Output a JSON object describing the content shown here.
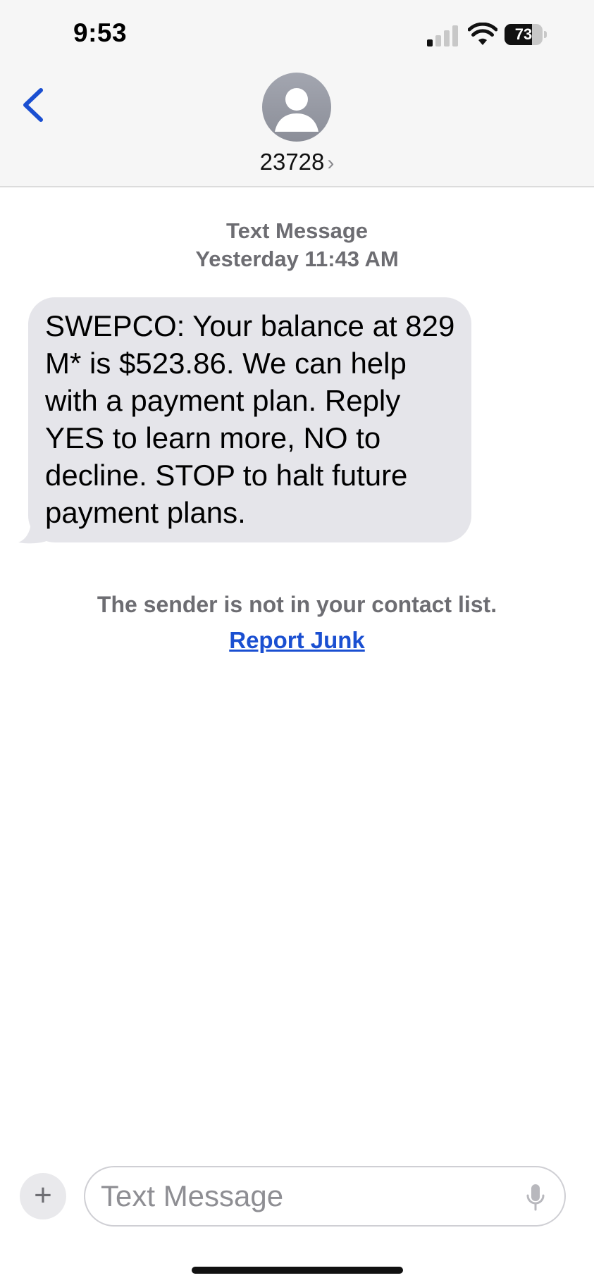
{
  "status_bar": {
    "time": "9:53",
    "battery": "73",
    "battery_level": 0.73,
    "signal_bars_active": 1,
    "signal_bars_total": 4
  },
  "header": {
    "contact_name": "23728",
    "chevron": "›",
    "back_icon": "chevron-left-icon",
    "avatar_icon": "person-icon"
  },
  "conversation": {
    "service_label": "Text Message",
    "timestamp": "Yesterday 11:43 AM",
    "message": "SWEPCO: Your balance at 829 M* is $523.86. We can help with a payment plan. Reply YES to learn more, NO to decline. STOP to halt future payment plans.",
    "notice": "The sender is not in your contact list.",
    "report_junk": "Report Junk"
  },
  "composer": {
    "placeholder": "Text Message",
    "value": "",
    "add_symbol": "+"
  },
  "colors": {
    "accent": "#1a4fd1",
    "bubble": "#e5e5ea",
    "meta_text": "#6d6d72",
    "header_bg": "#f6f6f6"
  }
}
